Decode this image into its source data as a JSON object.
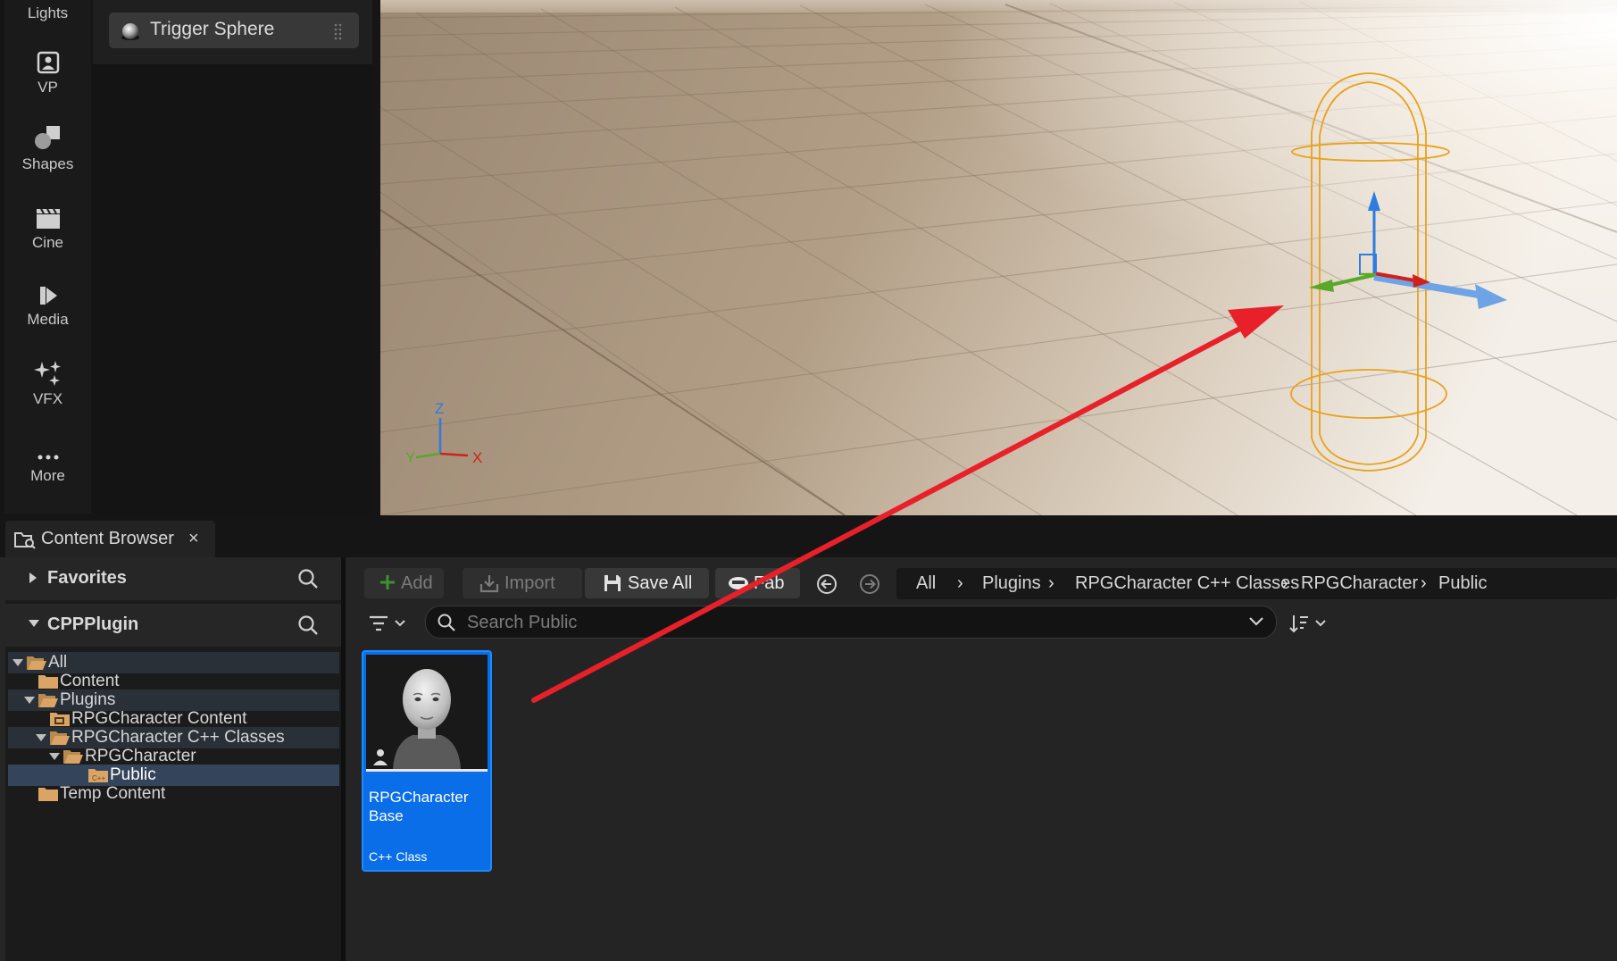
{
  "mode_toolbar": {
    "items": [
      {
        "label": "Lights",
        "icon": "lightbulb-icon"
      },
      {
        "label": "VP",
        "icon": "virtual-production-icon"
      },
      {
        "label": "Shapes",
        "icon": "shapes-icon"
      },
      {
        "label": "Cine",
        "icon": "clapperboard-icon"
      },
      {
        "label": "Media",
        "icon": "media-play-icon"
      },
      {
        "label": "VFX",
        "icon": "sparkles-icon"
      },
      {
        "label": "More",
        "icon": "ellipsis-icon"
      }
    ]
  },
  "place_panel": {
    "item_label": "Trigger Sphere",
    "item_icon": "sphere-icon"
  },
  "viewport": {
    "axis_labels": {
      "z": "Z",
      "y": "Y",
      "x": "X"
    },
    "colors": {
      "x_axis": "#d0221c",
      "y_axis": "#5aa829",
      "z_axis": "#2f7be0",
      "selection": "#e8a21c"
    }
  },
  "content_browser": {
    "tab_label": "Content Browser",
    "close_glyph": "×",
    "favorites_label": "Favorites",
    "project_label": "CPPPlugin",
    "tree": [
      {
        "label": "All",
        "depth": 0,
        "expanded": true,
        "selected": false
      },
      {
        "label": "Content",
        "depth": 1,
        "expanded": false,
        "selected": false
      },
      {
        "label": "Plugins",
        "depth": 1,
        "expanded": true,
        "selected": false
      },
      {
        "label": "RPGCharacter Content",
        "depth": 2,
        "expanded": false,
        "selected": false
      },
      {
        "label": "RPGCharacter C++ Classes",
        "depth": 2,
        "expanded": true,
        "selected": false
      },
      {
        "label": "RPGCharacter",
        "depth": 3,
        "expanded": true,
        "selected": false
      },
      {
        "label": "Public",
        "depth": 4,
        "expanded": false,
        "selected": true
      },
      {
        "label": "Temp Content",
        "depth": 1,
        "expanded": false,
        "selected": false
      }
    ],
    "toolbar": {
      "add_label": "Add",
      "import_label": "Import",
      "save_all_label": "Save All",
      "fab_label": "Fab"
    },
    "breadcrumb": [
      "All",
      "Plugins",
      "RPGCharacter C++ Classes",
      "RPGCharacter",
      "Public"
    ],
    "breadcrumb_separator": "›",
    "search": {
      "placeholder": "Search Public",
      "value": ""
    },
    "asset": {
      "name": "RPGCharacter Base",
      "type": "C++ Class",
      "selected_color": "#0a6ee8"
    }
  },
  "annotation": {
    "arrow_color": "#e8202a"
  }
}
